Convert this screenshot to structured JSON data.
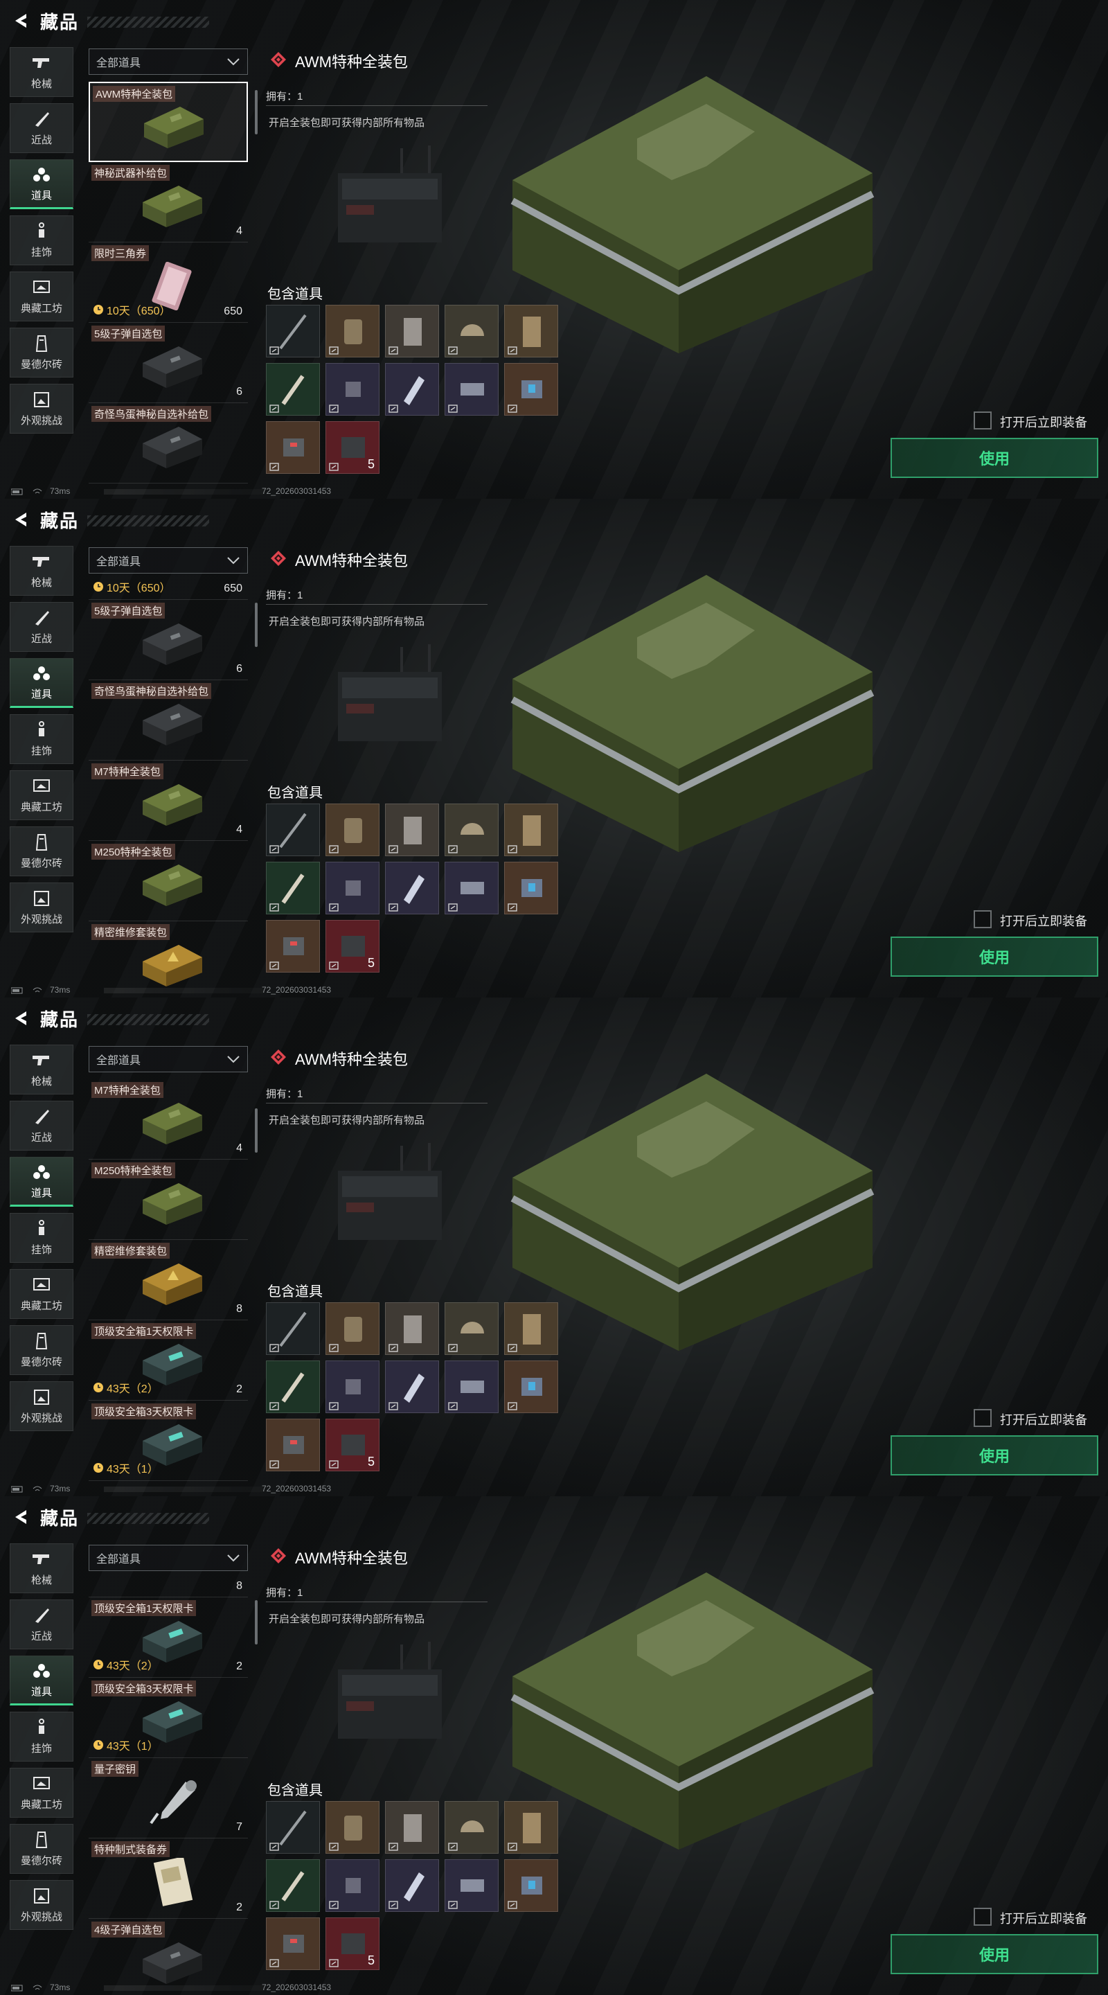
{
  "page_title": "藏品",
  "filter_label": "全部道具",
  "nav": [
    {
      "label": "枪械",
      "icon": "gun-icon"
    },
    {
      "label": "近战",
      "icon": "knife-icon"
    },
    {
      "label": "道具",
      "icon": "grenade-icon",
      "active": true
    },
    {
      "label": "挂饰",
      "icon": "charm-icon"
    },
    {
      "label": "典藏工坊",
      "icon": "workshop-icon"
    },
    {
      "label": "曼德尔砖",
      "icon": "brick-icon"
    },
    {
      "label": "外观挑战",
      "icon": "challenge-icon"
    }
  ],
  "detail": {
    "title": "AWM特种全装包",
    "owned": "拥有：1",
    "description": "开启全装包即可获得内部所有物品",
    "contains_label": "包含道具",
    "last_count": "5",
    "auto_equip_label": "打开后立即装备",
    "use_label": "使用"
  },
  "status": {
    "ping": "73ms",
    "build": "72_202603031453"
  },
  "frames": [
    {
      "items": [
        {
          "name": "AWM特种全装包",
          "qty": "",
          "selected": true,
          "art": "green-case"
        },
        {
          "name": "神秘武器补给包",
          "qty": "4",
          "art": "green-case"
        },
        {
          "name": "限时三角券",
          "qty": "650",
          "timer": "10天（650）",
          "art": "ticket"
        },
        {
          "name": "5级子弹自选包",
          "qty": "6",
          "art": "dark-case"
        },
        {
          "name": "奇怪鸟蛋神秘自选补给包",
          "qty": "",
          "art": "dark-case"
        }
      ]
    },
    {
      "items": [
        {
          "name": "",
          "qty": "650",
          "timer": "10天（650）",
          "art": "ticket",
          "partial": true
        },
        {
          "name": "5级子弹自选包",
          "qty": "6",
          "art": "dark-case"
        },
        {
          "name": "奇怪鸟蛋神秘自选补给包",
          "qty": "",
          "art": "dark-case"
        },
        {
          "name": "M7特种全装包",
          "qty": "4",
          "art": "green-case"
        },
        {
          "name": "M250特种全装包",
          "qty": "",
          "art": "green-case"
        },
        {
          "name": "精密维修套装包",
          "qty": "",
          "art": "yellow-case"
        }
      ]
    },
    {
      "items": [
        {
          "name": "M7特种全装包",
          "qty": "4",
          "art": "green-case"
        },
        {
          "name": "M250特种全装包",
          "qty": "",
          "art": "green-case"
        },
        {
          "name": "精密维修套装包",
          "qty": "8",
          "art": "yellow-case"
        },
        {
          "name": "顶级安全箱1天权限卡",
          "qty": "2",
          "timer": "43天（2）",
          "art": "teal-case"
        },
        {
          "name": "顶级安全箱3天权限卡",
          "qty": "",
          "timer": "43天（1）",
          "art": "teal-case"
        }
      ]
    },
    {
      "items": [
        {
          "name": "",
          "qty": "8",
          "art": "yellow-case",
          "partial": true
        },
        {
          "name": "顶级安全箱1天权限卡",
          "qty": "2",
          "timer": "43天（2）",
          "art": "teal-case"
        },
        {
          "name": "顶级安全箱3天权限卡",
          "qty": "",
          "timer": "43天（1）",
          "art": "teal-case"
        },
        {
          "name": "量子密钥",
          "qty": "7",
          "art": "key"
        },
        {
          "name": "特种制式装备券",
          "qty": "2",
          "art": "paper"
        },
        {
          "name": "4级子弹自选包",
          "qty": "",
          "art": "dark-case"
        }
      ]
    }
  ],
  "colors": {
    "accent": "#3fd68f",
    "timer": "#f4c455",
    "tag": "#7a5046",
    "diamond": "#e0454f"
  }
}
